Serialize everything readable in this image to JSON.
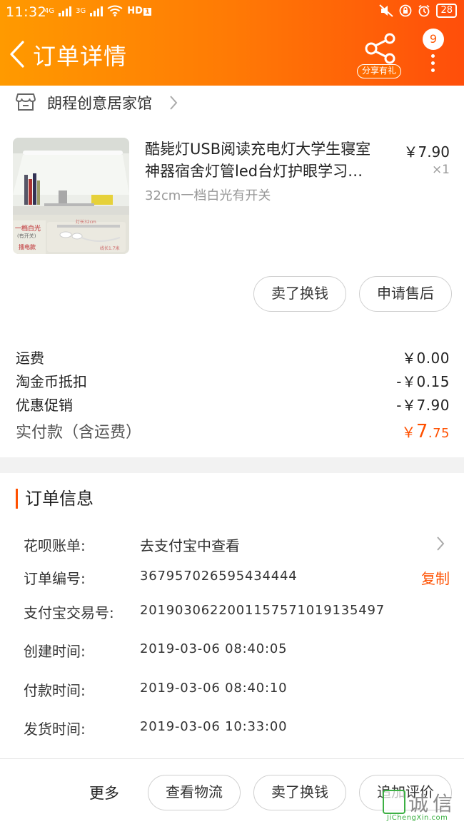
{
  "status_bar": {
    "time": "11:32",
    "net1": "4G",
    "net2": "3G",
    "hd": "HD",
    "hd_num": "1",
    "battery": "28"
  },
  "header": {
    "title": "订单详情",
    "share_label": "分享有礼",
    "badge_count": "9"
  },
  "shop": {
    "name": "朗程创意居家馆"
  },
  "product": {
    "title_line1": "酷毙灯USB阅读充电灯大学生寝室",
    "title_line2": "神器宿舍灯管led台灯护眼学习…",
    "sku": "32cm一档白光有开关",
    "price": "￥7.90",
    "qty": "×1",
    "image_texts": {
      "tag1": "一档白光",
      "tag2": "(有开关)",
      "tag3": "插电款",
      "dim1": "灯长32cm",
      "dim2": "线长1.7米"
    },
    "actions": [
      "卖了换钱",
      "申请售后"
    ]
  },
  "costs": {
    "shipping_label": "运费",
    "shipping_value": "￥0.00",
    "coin_label": "淘金币抵扣",
    "coin_value": "-￥0.15",
    "promo_label": "优惠促销",
    "promo_value": "-￥7.90",
    "paid_label": "实付款（含运费）",
    "paid_currency": "￥",
    "paid_int": "7",
    "paid_dec": ".75"
  },
  "order_info": {
    "section_title": "订单信息",
    "huabei_label": "花呗账单:",
    "huabei_value": "去支付宝中查看",
    "order_no_label": "订单编号:",
    "order_no_value": "367957026595434444",
    "copy_label": "复制",
    "alipay_label": "支付宝交易号:",
    "alipay_value": "2019030622001157571019135497",
    "created_label": "创建时间:",
    "created_value": "2019-03-06 08:40:05",
    "paid_time_label": "付款时间:",
    "paid_time_value": "2019-03-06 08:40:10",
    "ship_label": "发货时间:",
    "ship_value": "2019-03-06 10:33:00"
  },
  "footer": {
    "more": "更多",
    "buttons": [
      "查看物流",
      "卖了换钱",
      "追加评价"
    ]
  },
  "watermark": {
    "char1": "诚",
    "char2": "信",
    "url": "JiChengXin.com"
  },
  "colors": {
    "accent": "#ff5000",
    "header_start": "#ff9a00",
    "header_end": "#ff4e0a"
  }
}
